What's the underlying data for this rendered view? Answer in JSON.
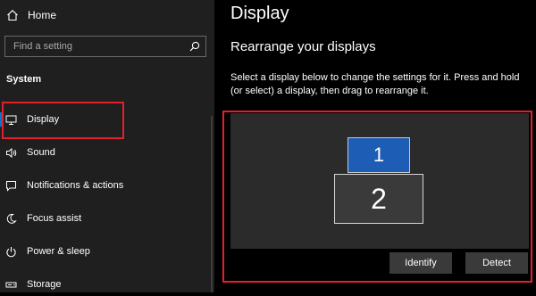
{
  "sidebar": {
    "home_label": "Home",
    "search_placeholder": "Find a setting",
    "section_label": "System",
    "items": [
      {
        "label": "Display",
        "icon": "monitor-icon",
        "selected": true
      },
      {
        "label": "Sound",
        "icon": "speaker-icon"
      },
      {
        "label": "Notifications & actions",
        "icon": "notification-icon"
      },
      {
        "label": "Focus assist",
        "icon": "moon-icon"
      },
      {
        "label": "Power & sleep",
        "icon": "power-icon"
      },
      {
        "label": "Storage",
        "icon": "storage-icon"
      }
    ]
  },
  "main": {
    "title": "Display",
    "subtitle": "Rearrange your displays",
    "description": "Select a display below to change the settings for it. Press and hold (or select) a display, then drag to rearrange it.",
    "monitors": [
      {
        "label": "1",
        "selected": true
      },
      {
        "label": "2"
      }
    ],
    "identify_label": "Identify",
    "detect_label": "Detect"
  },
  "colors": {
    "accent": "#0078d4",
    "highlight": "#e3212a",
    "sidebar_bg": "#1f1f1f",
    "main_bg": "#000000",
    "monitor_selected": "#1e5db5"
  }
}
